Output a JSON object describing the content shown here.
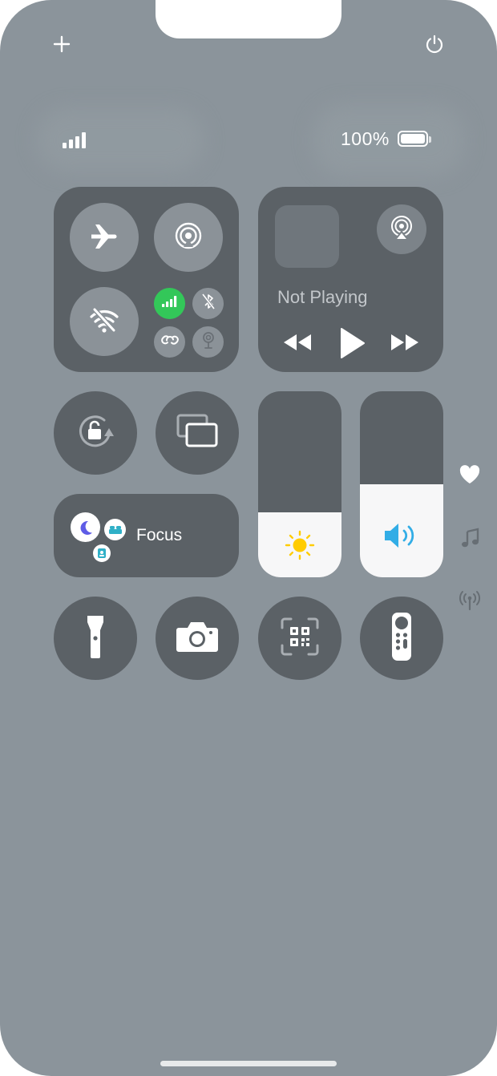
{
  "status": {
    "battery_percent": "100%",
    "battery_level": 1.0,
    "signal_bars": 4
  },
  "top_controls": {
    "add_icon": "plus-icon",
    "power_icon": "power-icon"
  },
  "connectivity": {
    "airplane_mode": {
      "icon": "airplane-icon",
      "on": false
    },
    "airdrop": {
      "icon": "airdrop-icon",
      "on": false
    },
    "wifi": {
      "icon": "wifi-off-icon",
      "on": false
    },
    "cellular": {
      "icon": "cellular-icon",
      "on": true,
      "color": "#33c759"
    },
    "bluetooth": {
      "icon": "bluetooth-off-icon",
      "on": false
    },
    "personal_hotspot": {
      "icon": "link-icon",
      "on": false
    },
    "satellite": {
      "icon": "satellite-icon",
      "on": false
    }
  },
  "now_playing": {
    "title": "Not Playing",
    "airplay_icon": "airplay-icon",
    "controls": [
      "rewind-icon",
      "play-icon",
      "fast-forward-icon"
    ]
  },
  "controls": {
    "orientation_lock_icon": "rotation-lock-icon",
    "screen_mirroring_icon": "screen-mirroring-icon",
    "focus": {
      "label": "Focus",
      "icons": [
        "moon-icon",
        "bed-icon",
        "badge-icon"
      ],
      "moon_color": "#5e5ce6",
      "sleep_color": "#30b0c7"
    },
    "brightness": {
      "icon": "sun-icon",
      "level": 0.35,
      "color": "#ffcc00"
    },
    "volume": {
      "icon": "speaker-icon",
      "level": 0.5,
      "color": "#32ade6"
    }
  },
  "bottom_row": [
    "flashlight-icon",
    "camera-icon",
    "qr-scanner-icon",
    "remote-icon"
  ],
  "side_indicators": [
    "heart-icon",
    "music-note-icon",
    "antenna-icon"
  ]
}
